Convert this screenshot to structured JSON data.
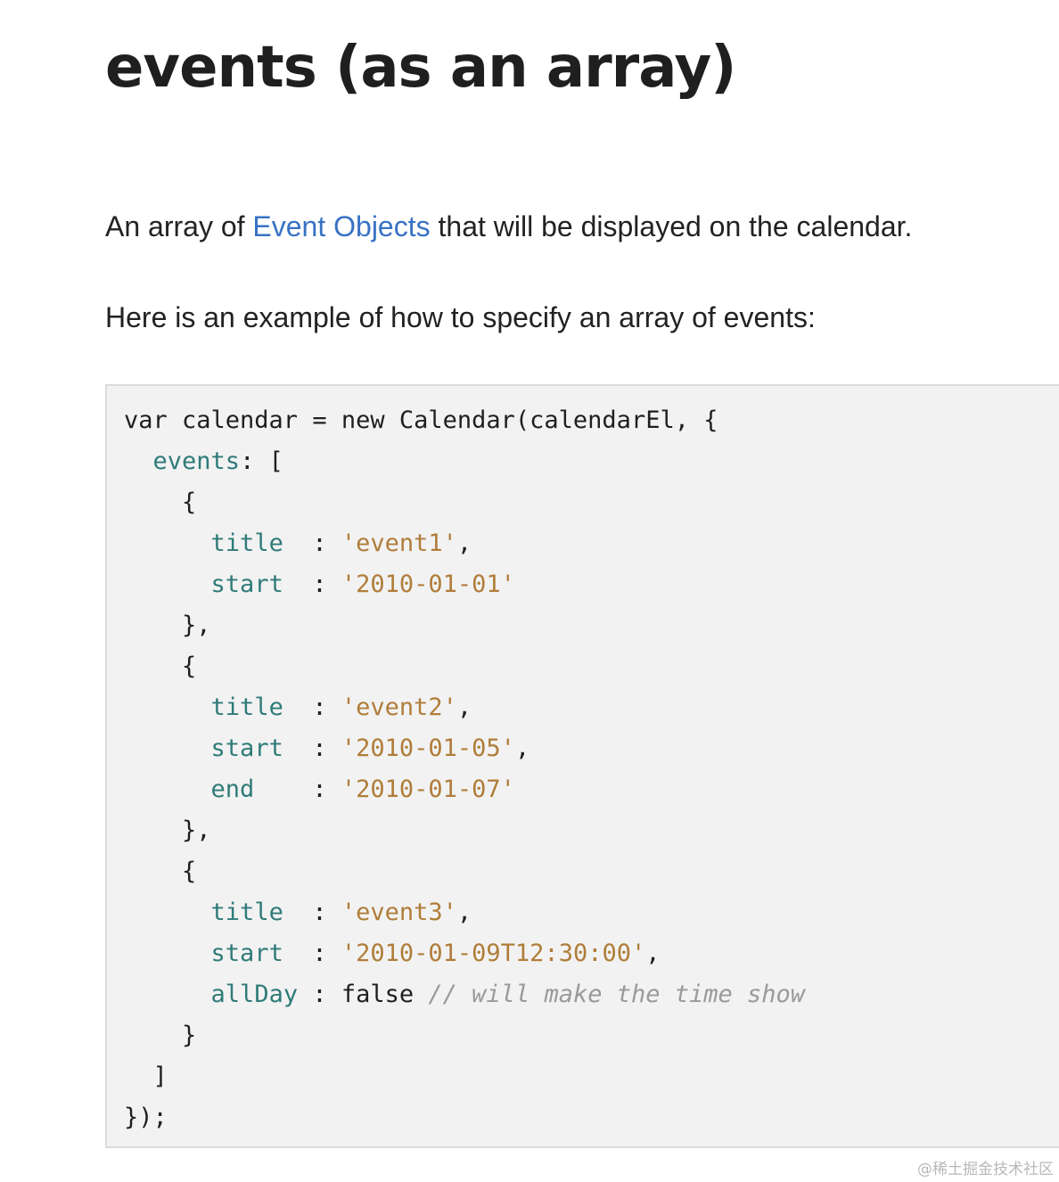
{
  "header": {
    "title": "events (as an array)"
  },
  "content": {
    "intro_before_link": "An array of ",
    "intro_link": "Event Objects",
    "intro_after_link": " that will be displayed on the calendar.",
    "example_intro": "Here is an example of how to specify an array of events:"
  },
  "code": {
    "lines": [
      [
        {
          "t": "var calendar = new Calendar(calendarEl, {",
          "k": "plain"
        }
      ],
      [
        {
          "t": "  ",
          "k": "plain"
        },
        {
          "t": "events",
          "k": "key"
        },
        {
          "t": ": [",
          "k": "plain"
        }
      ],
      [
        {
          "t": "    {",
          "k": "plain"
        }
      ],
      [
        {
          "t": "      ",
          "k": "plain"
        },
        {
          "t": "title",
          "k": "key"
        },
        {
          "t": "  : ",
          "k": "plain"
        },
        {
          "t": "'event1'",
          "k": "str"
        },
        {
          "t": ",",
          "k": "plain"
        }
      ],
      [
        {
          "t": "      ",
          "k": "plain"
        },
        {
          "t": "start",
          "k": "key"
        },
        {
          "t": "  : ",
          "k": "plain"
        },
        {
          "t": "'2010-01-01'",
          "k": "str"
        }
      ],
      [
        {
          "t": "    },",
          "k": "plain"
        }
      ],
      [
        {
          "t": "    {",
          "k": "plain"
        }
      ],
      [
        {
          "t": "      ",
          "k": "plain"
        },
        {
          "t": "title",
          "k": "key"
        },
        {
          "t": "  : ",
          "k": "plain"
        },
        {
          "t": "'event2'",
          "k": "str"
        },
        {
          "t": ",",
          "k": "plain"
        }
      ],
      [
        {
          "t": "      ",
          "k": "plain"
        },
        {
          "t": "start",
          "k": "key"
        },
        {
          "t": "  : ",
          "k": "plain"
        },
        {
          "t": "'2010-01-05'",
          "k": "str"
        },
        {
          "t": ",",
          "k": "plain"
        }
      ],
      [
        {
          "t": "      ",
          "k": "plain"
        },
        {
          "t": "end",
          "k": "key"
        },
        {
          "t": "    : ",
          "k": "plain"
        },
        {
          "t": "'2010-01-07'",
          "k": "str"
        }
      ],
      [
        {
          "t": "    },",
          "k": "plain"
        }
      ],
      [
        {
          "t": "    {",
          "k": "plain"
        }
      ],
      [
        {
          "t": "      ",
          "k": "plain"
        },
        {
          "t": "title",
          "k": "key"
        },
        {
          "t": "  : ",
          "k": "plain"
        },
        {
          "t": "'event3'",
          "k": "str"
        },
        {
          "t": ",",
          "k": "plain"
        }
      ],
      [
        {
          "t": "      ",
          "k": "plain"
        },
        {
          "t": "start",
          "k": "key"
        },
        {
          "t": "  : ",
          "k": "plain"
        },
        {
          "t": "'2010-01-09T12:30:00'",
          "k": "str"
        },
        {
          "t": ",",
          "k": "plain"
        }
      ],
      [
        {
          "t": "      ",
          "k": "plain"
        },
        {
          "t": "allDay",
          "k": "key"
        },
        {
          "t": " : false ",
          "k": "plain"
        },
        {
          "t": "// will make the time show",
          "k": "com"
        }
      ],
      [
        {
          "t": "    }",
          "k": "plain"
        }
      ],
      [
        {
          "t": "  ]",
          "k": "plain"
        }
      ],
      [
        {
          "t": "});",
          "k": "plain"
        }
      ]
    ]
  },
  "watermark": "@稀土掘金技术社区",
  "colors": {
    "link": "#3872c4",
    "code_key": "#2f7b78",
    "code_string": "#b07d3a",
    "code_comment": "#9a9a9a",
    "code_background": "#f2f2f2"
  }
}
